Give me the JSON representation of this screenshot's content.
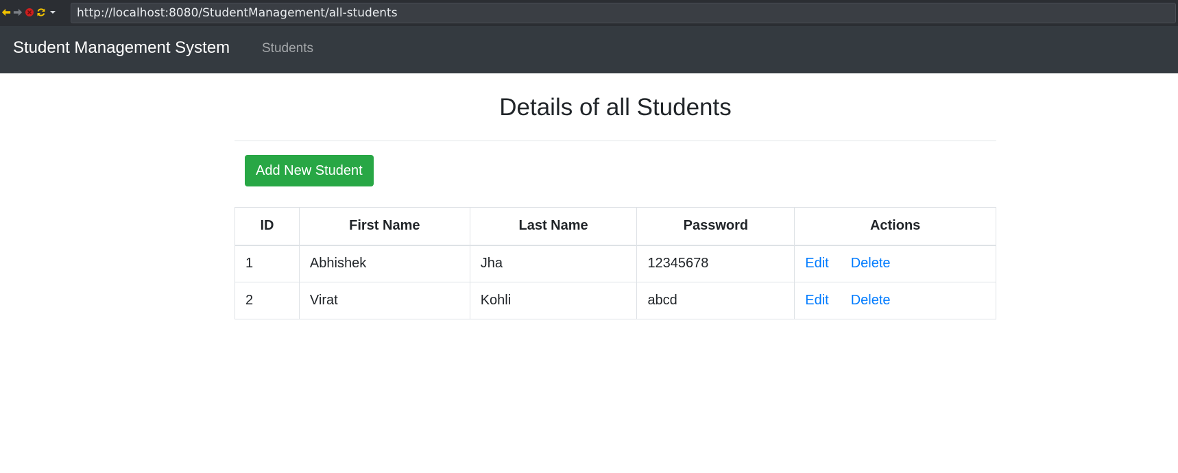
{
  "browser": {
    "url": "http://localhost:8080/StudentManagement/all-students"
  },
  "navbar": {
    "brand": "Student Management System",
    "links": [
      {
        "label": "Students"
      }
    ]
  },
  "main": {
    "title": "Details of all Students",
    "add_button_label": "Add New Student",
    "table": {
      "headers": [
        "ID",
        "First Name",
        "Last Name",
        "Password",
        "Actions"
      ],
      "rows": [
        {
          "id": "1",
          "first_name": "Abhishek",
          "last_name": "Jha",
          "password": "12345678",
          "edit_label": "Edit",
          "delete_label": "Delete"
        },
        {
          "id": "2",
          "first_name": "Virat",
          "last_name": "Kohli",
          "password": "abcd",
          "edit_label": "Edit",
          "delete_label": "Delete"
        }
      ]
    }
  },
  "colors": {
    "navbar_bg": "#343a40",
    "success": "#28a745",
    "link": "#007bff"
  }
}
